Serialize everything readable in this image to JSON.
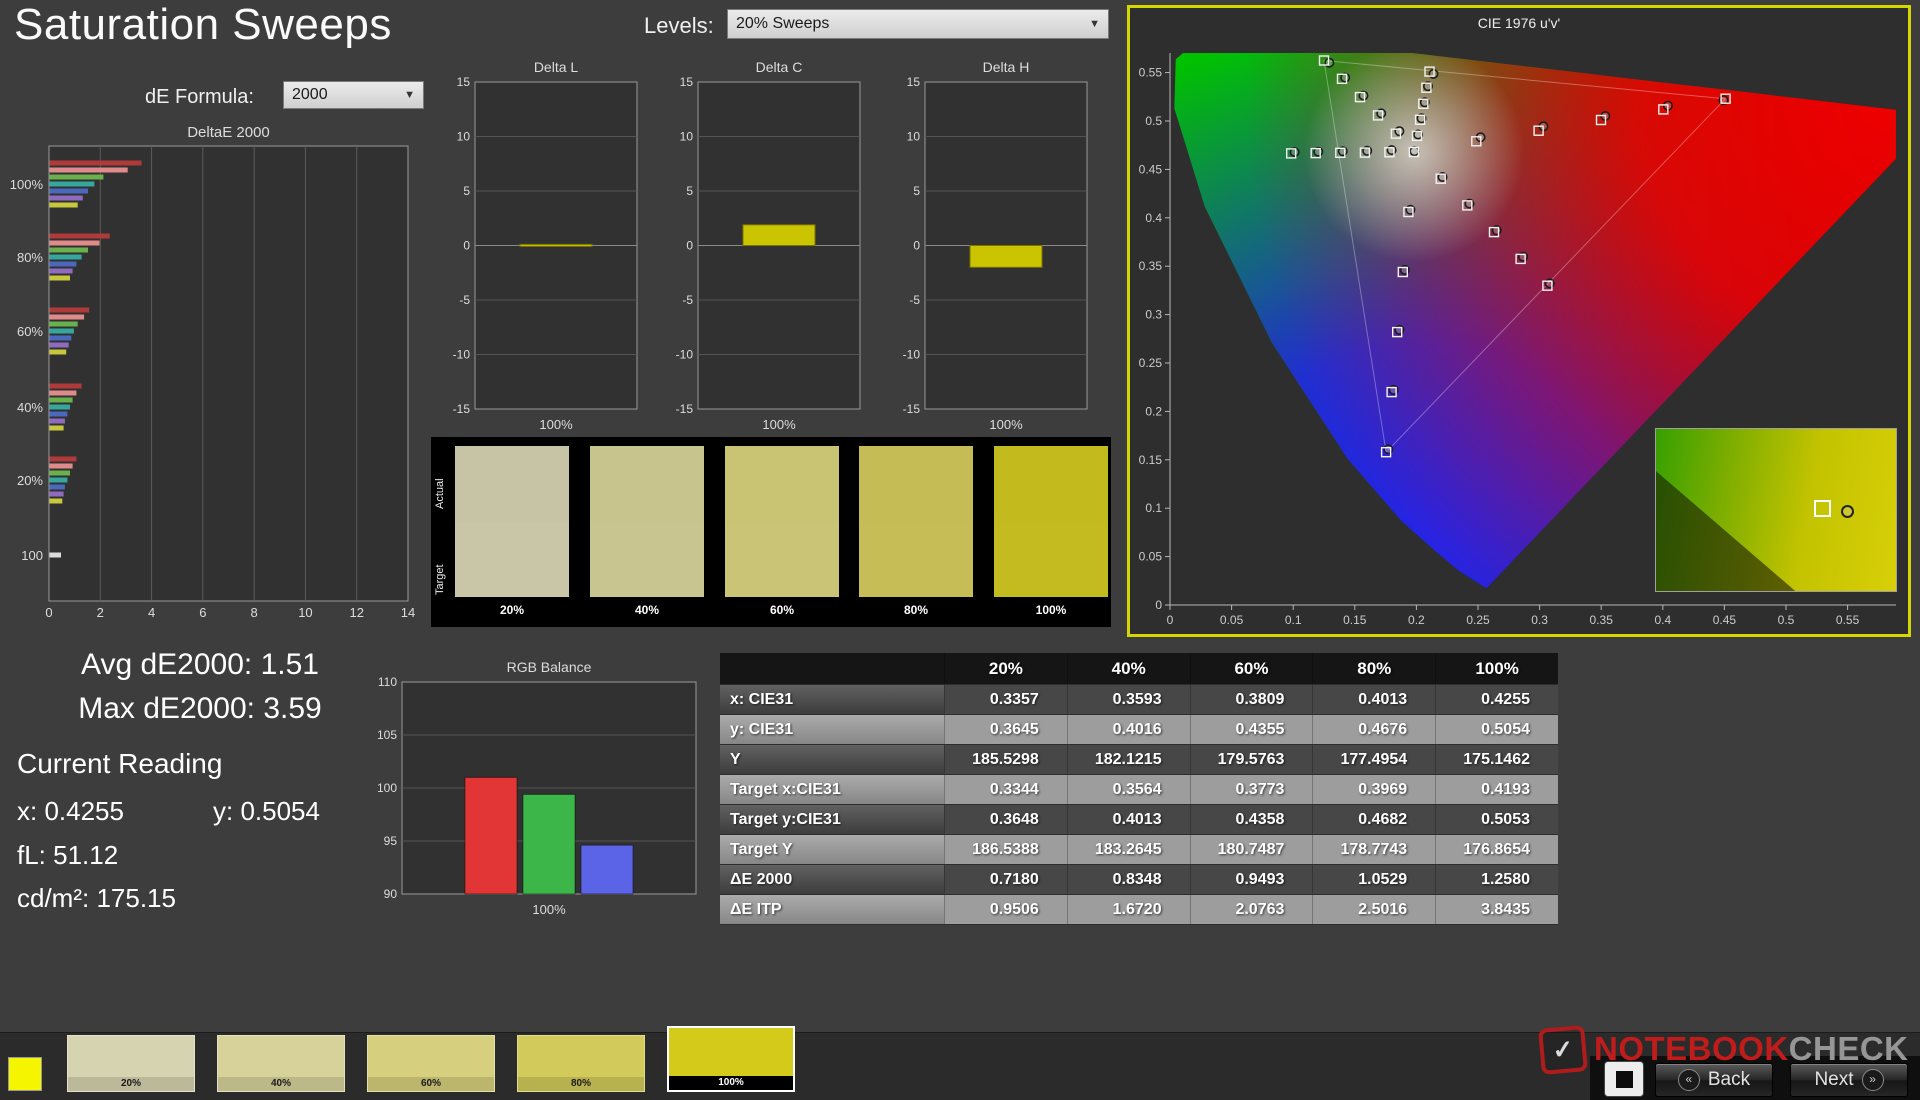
{
  "page": {
    "title": "Saturation Sweeps"
  },
  "controls": {
    "levels_label": "Levels:",
    "levels_value": "20% Sweeps",
    "formula_label": "dE Formula:",
    "formula_value": "2000"
  },
  "deltae_chart": {
    "type": "bar",
    "title": "DeltaE 2000",
    "xlim": [
      0,
      14
    ],
    "xticks": [
      0,
      2,
      4,
      6,
      8,
      10,
      12,
      14
    ],
    "bar_colors": [
      "#b03a3a",
      "#e08a8a",
      "#6ab04c",
      "#35a79c",
      "#4a69bd",
      "#8e6bbf",
      "#c8c83c"
    ],
    "groups": [
      {
        "label": "100%",
        "values": [
          3.59,
          3.05,
          2.1,
          1.75,
          1.5,
          1.3,
          1.1
        ]
      },
      {
        "label": "80%",
        "values": [
          2.35,
          1.95,
          1.5,
          1.25,
          1.05,
          0.9,
          0.8
        ]
      },
      {
        "label": "60%",
        "values": [
          1.55,
          1.35,
          1.1,
          0.95,
          0.85,
          0.75,
          0.65
        ]
      },
      {
        "label": "40%",
        "values": [
          1.25,
          1.05,
          0.9,
          0.8,
          0.7,
          0.6,
          0.55
        ]
      },
      {
        "label": "20%",
        "values": [
          1.05,
          0.9,
          0.8,
          0.7,
          0.6,
          0.55,
          0.5
        ]
      },
      {
        "label": "100",
        "values": [
          0.45
        ]
      }
    ]
  },
  "delta_charts": {
    "config": {
      "ylim": [
        -15,
        15
      ],
      "yticks": [
        "15",
        "10",
        "5",
        "0",
        "-5",
        "-10",
        "-15"
      ],
      "xlabel": "100%",
      "bar_color": "#cbc400"
    },
    "charts": [
      {
        "type": "bar",
        "title": "Delta L",
        "value": 0.1
      },
      {
        "type": "bar",
        "title": "Delta C",
        "value": 1.9
      },
      {
        "type": "bar",
        "title": "Delta H",
        "value": -2.0
      }
    ]
  },
  "swatches": {
    "row_labels": [
      "Actual",
      "Target"
    ],
    "items": [
      {
        "label": "20%",
        "actual": "#c7c4a6",
        "target": "#c9c6a8"
      },
      {
        "label": "40%",
        "actual": "#c8c48e",
        "target": "#c9c591"
      },
      {
        "label": "60%",
        "actual": "#c9c474",
        "target": "#cac576"
      },
      {
        "label": "80%",
        "actual": "#c5bc55",
        "target": "#c6bd57"
      },
      {
        "label": "100%",
        "actual": "#c3ba1e",
        "target": "#c4bb20"
      }
    ]
  },
  "cie": {
    "title": "CIE 1976 u'v'",
    "border_color": "#d6d600",
    "axis_ticks": [
      "0",
      "0.05",
      "0.1",
      "0.15",
      "0.2",
      "0.25",
      "0.3",
      "0.35",
      "0.4",
      "0.45",
      "0.5",
      "0.55"
    ],
    "locus": [
      [
        0.2568,
        0.0172
      ],
      [
        0.2347,
        0.035
      ],
      [
        0.2161,
        0.0549
      ],
      [
        0.1877,
        0.0871
      ],
      [
        0.1441,
        0.151
      ],
      [
        0.0828,
        0.2708
      ],
      [
        0.0282,
        0.4117
      ],
      [
        0.0035,
        0.5131
      ],
      [
        0.0046,
        0.5639
      ],
      [
        0.0231,
        0.5837
      ],
      [
        0.0501,
        0.5868
      ],
      [
        0.0792,
        0.5856
      ],
      [
        0.1127,
        0.5823
      ],
      [
        0.1531,
        0.5766
      ],
      [
        0.2026,
        0.5693
      ],
      [
        0.2623,
        0.5604
      ],
      [
        0.3316,
        0.5501
      ],
      [
        0.4035,
        0.5393
      ],
      [
        0.4692,
        0.5296
      ],
      [
        0.5202,
        0.5219
      ],
      [
        0.6234,
        0.5065
      ]
    ],
    "triangle": [
      [
        0.4507,
        0.5229
      ],
      [
        0.125,
        0.5625
      ],
      [
        0.1754,
        0.1579
      ]
    ],
    "white_point": [
      0.198,
      0.468
    ],
    "targets": [
      [
        0.198,
        0.468
      ],
      [
        0.2486,
        0.479
      ],
      [
        0.2992,
        0.49
      ],
      [
        0.3498,
        0.501
      ],
      [
        0.4004,
        0.512
      ],
      [
        0.451,
        0.523
      ],
      [
        0.1834,
        0.4869
      ],
      [
        0.1688,
        0.5058
      ],
      [
        0.1542,
        0.5247
      ],
      [
        0.1396,
        0.5436
      ],
      [
        0.125,
        0.5625
      ],
      [
        0.1935,
        0.406
      ],
      [
        0.189,
        0.344
      ],
      [
        0.1844,
        0.2819
      ],
      [
        0.1799,
        0.2199
      ],
      [
        0.1754,
        0.1579
      ],
      [
        0.1781,
        0.4677
      ],
      [
        0.1582,
        0.4674
      ],
      [
        0.1382,
        0.4671
      ],
      [
        0.1183,
        0.4668
      ],
      [
        0.0984,
        0.4665
      ],
      [
        0.2197,
        0.4404
      ],
      [
        0.2413,
        0.4128
      ],
      [
        0.263,
        0.3852
      ],
      [
        0.2846,
        0.3575
      ],
      [
        0.3063,
        0.3299
      ],
      [
        0.2005,
        0.4846
      ],
      [
        0.203,
        0.5012
      ],
      [
        0.2056,
        0.5178
      ],
      [
        0.2081,
        0.5344
      ],
      [
        0.2106,
        0.551
      ]
    ],
    "measured": [
      [
        0.1984,
        0.4688
      ],
      [
        0.2521,
        0.4832
      ],
      [
        0.3031,
        0.4945
      ],
      [
        0.3533,
        0.5052
      ],
      [
        0.4041,
        0.5158
      ],
      [
        0.4493,
        0.5215
      ],
      [
        0.1862,
        0.4895
      ],
      [
        0.1714,
        0.5079
      ],
      [
        0.1571,
        0.5262
      ],
      [
        0.1422,
        0.5448
      ],
      [
        0.1293,
        0.5602
      ],
      [
        0.1951,
        0.4083
      ],
      [
        0.1906,
        0.3462
      ],
      [
        0.1862,
        0.2842
      ],
      [
        0.1815,
        0.2222
      ],
      [
        0.1772,
        0.1608
      ],
      [
        0.1799,
        0.4699
      ],
      [
        0.1601,
        0.4692
      ],
      [
        0.1403,
        0.4688
      ],
      [
        0.1204,
        0.4683
      ],
      [
        0.1012,
        0.4679
      ],
      [
        0.2212,
        0.4421
      ],
      [
        0.2431,
        0.4147
      ],
      [
        0.2652,
        0.3871
      ],
      [
        0.2866,
        0.3598
      ],
      [
        0.3082,
        0.3322
      ],
      [
        0.2014,
        0.4861
      ],
      [
        0.2041,
        0.5028
      ],
      [
        0.2068,
        0.5193
      ],
      [
        0.2094,
        0.5359
      ],
      [
        0.2139,
        0.5487
      ]
    ]
  },
  "readings": {
    "avg": "Avg dE2000: 1.51",
    "max": "Max dE2000: 3.59",
    "heading": "Current Reading",
    "x": "x: 0.4255",
    "y": "y: 0.5054",
    "fl": "fL: 51.12",
    "cdm2": "cd/m²: 175.15"
  },
  "rgb_chart": {
    "type": "bar",
    "title": "RGB Balance",
    "ylim": [
      90,
      110
    ],
    "yticks": [
      "110",
      "105",
      "100",
      "95",
      "90"
    ],
    "xlabel": "100%",
    "series": [
      {
        "name": "Red",
        "value": 101.0,
        "color": "#e23535"
      },
      {
        "name": "Green",
        "value": 99.4,
        "color": "#3cb649"
      },
      {
        "name": "Blue",
        "value": 94.6,
        "color": "#5b63e6"
      }
    ]
  },
  "table": {
    "columns": [
      "",
      "20%",
      "40%",
      "60%",
      "80%",
      "100%"
    ],
    "rows": [
      {
        "label": "x: CIE31",
        "values": [
          "0.3357",
          "0.3593",
          "0.3809",
          "0.4013",
          "0.4255"
        ]
      },
      {
        "label": "y: CIE31",
        "values": [
          "0.3645",
          "0.4016",
          "0.4355",
          "0.4676",
          "0.5054"
        ]
      },
      {
        "label": "Y",
        "values": [
          "185.5298",
          "182.1215",
          "179.5763",
          "177.4954",
          "175.1462"
        ]
      },
      {
        "label": "Target x:CIE31",
        "values": [
          "0.3344",
          "0.3564",
          "0.3773",
          "0.3969",
          "0.4193"
        ]
      },
      {
        "label": "Target y:CIE31",
        "values": [
          "0.3648",
          "0.4013",
          "0.4358",
          "0.4682",
          "0.5053"
        ]
      },
      {
        "label": "Target Y",
        "values": [
          "186.5388",
          "183.2645",
          "180.7487",
          "178.7743",
          "176.8654"
        ]
      },
      {
        "label": "ΔE 2000",
        "values": [
          "0.7180",
          "0.8348",
          "0.9493",
          "1.0529",
          "1.2580"
        ]
      },
      {
        "label": "ΔE ITP",
        "values": [
          "0.9506",
          "1.6720",
          "2.0763",
          "2.5016",
          "3.8435"
        ]
      }
    ]
  },
  "bottom": {
    "current_color": "#f5f500",
    "tiles": [
      {
        "label": "20%",
        "color": "#d6d3b0",
        "selected": false
      },
      {
        "label": "40%",
        "color": "#d6d29a",
        "selected": false
      },
      {
        "label": "60%",
        "color": "#d5cf7e",
        "selected": false
      },
      {
        "label": "80%",
        "color": "#d2ca5b",
        "selected": false
      },
      {
        "label": "100%",
        "color": "#d4ca1a",
        "selected": true
      }
    ]
  },
  "footer": {
    "brand_red": "NOTEBOOK",
    "brand_gray": "CHECK",
    "back": "Back",
    "next": "Next"
  }
}
